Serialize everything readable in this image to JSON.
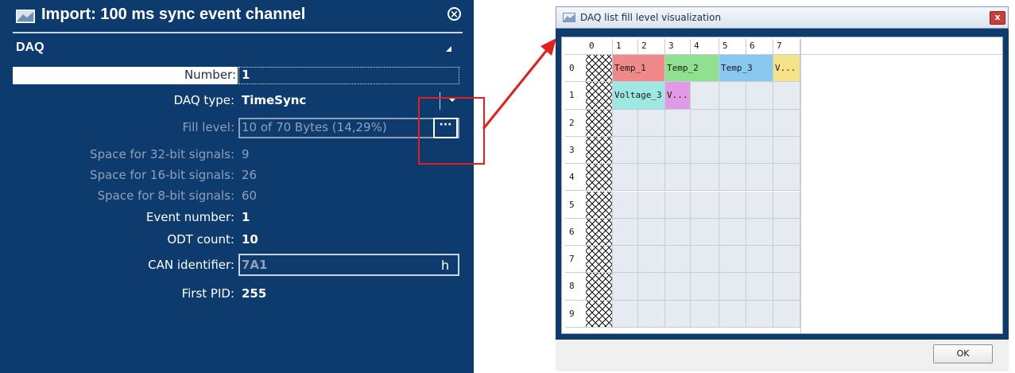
{
  "left_panel": {
    "title": "Import: 100 ms sync event channel",
    "section": "DAQ",
    "properties": {
      "number_label": "Number:",
      "number_value": "1",
      "daq_type_label": "DAQ type:",
      "daq_type_value": "TimeSync",
      "fill_level_label": "Fill level:",
      "fill_level_value": "10 of 70 Bytes (14,29%)",
      "fill_level_button": "···",
      "space32_label": "Space for 32-bit signals:",
      "space32_value": "9",
      "space16_label": "Space for 16-bit signals:",
      "space16_value": "26",
      "space8_label": "Space for 8-bit signals:",
      "space8_value": "60",
      "event_number_label": "Event number:",
      "event_number_value": "1",
      "odt_count_label": "ODT count:",
      "odt_count_value": "10",
      "can_id_label": "CAN identifier:",
      "can_id_value": "7A1",
      "can_id_suffix": "h",
      "first_pid_label": "First PID:",
      "first_pid_value": "255"
    }
  },
  "dialog": {
    "title": "DAQ list fill level visualization",
    "ok_label": "OK",
    "columns": [
      "0",
      "1",
      "2",
      "3",
      "4",
      "5",
      "6",
      "7"
    ],
    "rows": [
      "0",
      "1",
      "2",
      "3",
      "4",
      "5",
      "6",
      "7",
      "8",
      "9"
    ],
    "signals": [
      {
        "label": "Temp_1",
        "color": "#f08a8a"
      },
      {
        "label": "Temp_2",
        "color": "#8fe08f"
      },
      {
        "label": "Temp_3",
        "color": "#89c8f0"
      },
      {
        "label": "V...",
        "color": "#f5e38a"
      },
      {
        "label": "Voltage_3",
        "color": "#9ee8e4"
      },
      {
        "label": "V...",
        "color": "#e19ae6"
      }
    ]
  },
  "colors": {
    "panel_bg": "#0e3b6e",
    "highlight": "#e31e1e"
  }
}
